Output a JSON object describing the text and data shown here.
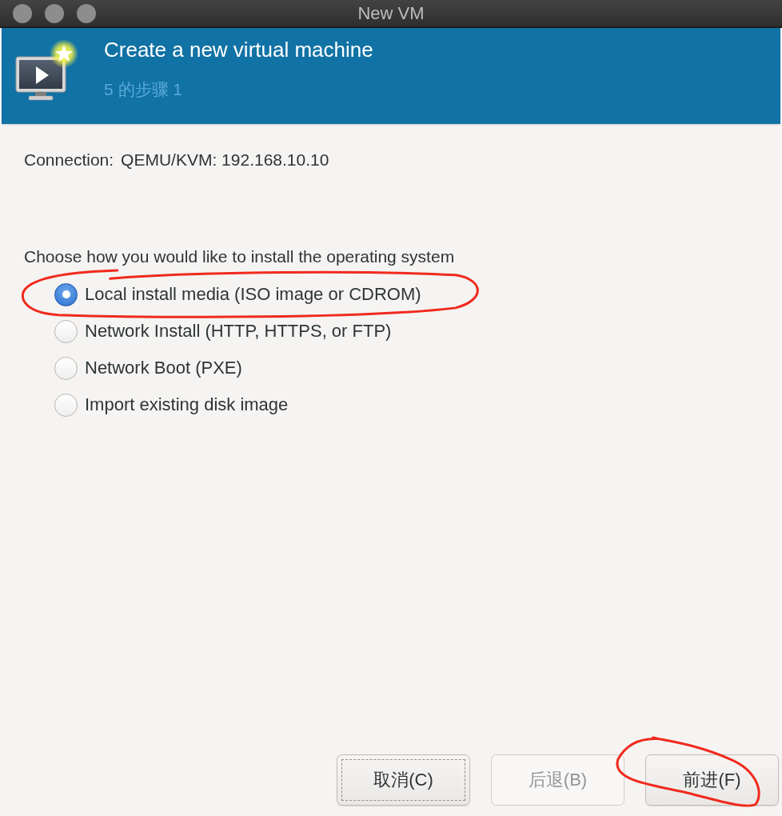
{
  "window": {
    "title": "New VM"
  },
  "header": {
    "title": "Create a new virtual machine",
    "step": "5 的步骤 1"
  },
  "connection": {
    "label": "Connection:",
    "value": "QEMU/KVM: 192.168.10.10"
  },
  "install_method": {
    "prompt": "Choose how you would like to install the operating system",
    "options": [
      {
        "label": "Local install media (ISO image or CDROM)",
        "selected": true,
        "circled": true
      },
      {
        "label": "Network Install (HTTP, HTTPS, or FTP)",
        "selected": false,
        "circled": false
      },
      {
        "label": "Network Boot (PXE)",
        "selected": false,
        "circled": false
      },
      {
        "label": "Import existing disk image",
        "selected": false,
        "circled": false
      }
    ]
  },
  "buttons": [
    {
      "label": "取消(C)",
      "focused": true,
      "disabled": false,
      "circled": false
    },
    {
      "label": "后退(B)",
      "focused": false,
      "disabled": true,
      "circled": false
    },
    {
      "label": "前进(F)",
      "focused": false,
      "disabled": false,
      "circled": true
    }
  ]
}
